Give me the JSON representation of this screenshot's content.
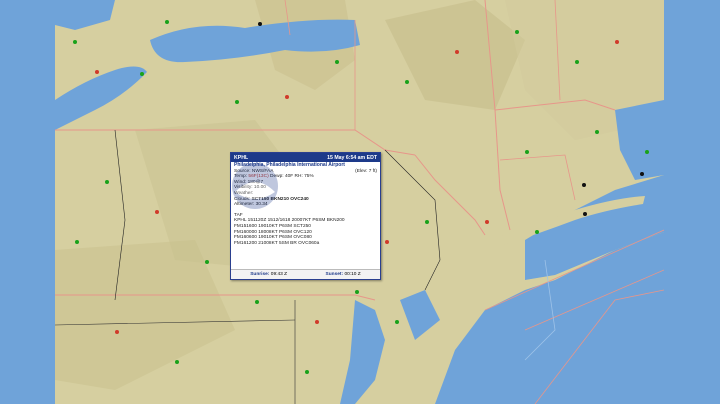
{
  "popup": {
    "station_id": "KPHL",
    "time": "15 May 6:54 am EDT",
    "name": "Philadelphia, Philadelphia International Airport",
    "source": "Source: NWS/FAA",
    "elev": "(Elev: 7 ft)",
    "temp_label": "Temp:",
    "temp_value": "56F(13C)",
    "dewp": "Dewp: 40F RH: 75%",
    "wind": "Wind: 180@7",
    "visibility": "Visibility: 10.00",
    "weather": "Weather:",
    "clouds_label": "Clouds:",
    "clouds_value": "SCT150 BKN210 OVC240",
    "altimeter": "Altimeter: 30.34",
    "taf_label": "TAF",
    "taf_lines": [
      "KPHL 151120Z 1512/1618 20007KT P6SM BKN200",
      "FM151600 19010KT P6SM SCT250",
      "FM160000 18008KT P6SM OVC120",
      "FM160600 19010KT P6SM OVC080",
      "FM161200 21008KT 5SM BR OVC060a"
    ],
    "sunrise_label": "Sunrise:",
    "sunrise_value": "09:43 Z",
    "sunset_label": "Sunset:",
    "sunset_value": "00:10 Z"
  },
  "colors": {
    "water": "#6fa3d9",
    "land": "#d9d2a6",
    "state_border": "#e7968a",
    "popup_header": "#1d3a8a",
    "station_green": "#1aa21a",
    "station_red": "#d03a2a"
  }
}
